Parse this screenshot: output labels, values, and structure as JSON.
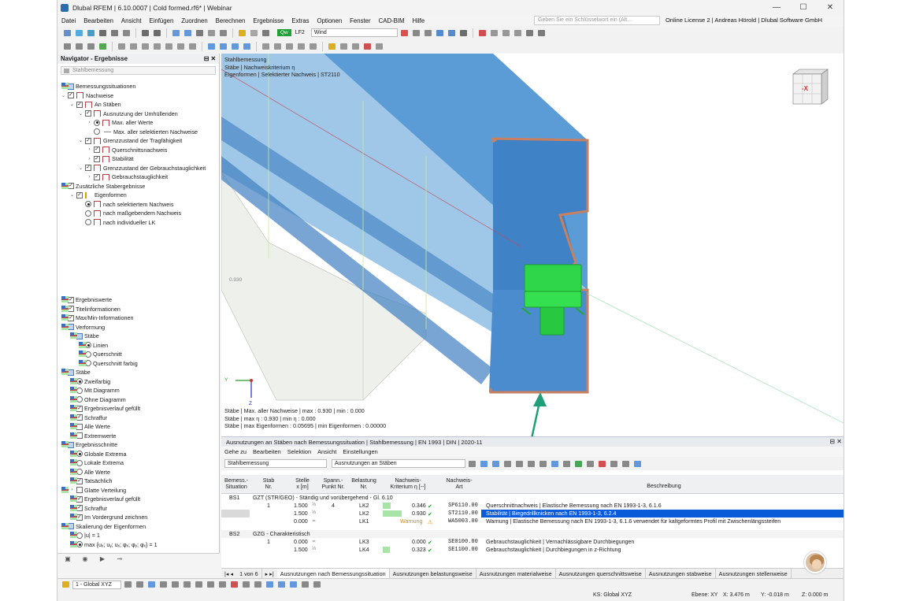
{
  "window": {
    "title": "Dlubal RFEM | 6.10.0007 | Cold formed.rf6* | Webinar",
    "controls": [
      "—",
      "☐",
      "✕"
    ]
  },
  "menu": [
    "Datei",
    "Bearbeiten",
    "Ansicht",
    "Einfügen",
    "Zuordnen",
    "Berechnen",
    "Ergebnisse",
    "Extras",
    "Optionen",
    "Fenster",
    "CAD-BIM",
    "Hilfe"
  ],
  "search": {
    "placeholder": "Geben Sie ein Schlüsselwort ein (Alt..."
  },
  "license": "Online License 2 | Andreas Hörold | Dlubal Software GmbH",
  "toolbar": {
    "qw_badge": "Qw",
    "lc_label": "LF2",
    "lc_name": "Wind"
  },
  "navigator": {
    "title": "Navigator - Ergebnisse",
    "combo": "Stahlbemessung",
    "top_items": [
      {
        "label": "Bemessungssituationen"
      },
      {
        "label": "Nachweise"
      },
      {
        "label": "An Stäben"
      },
      {
        "label": "Ausnutzung der Umhüllenden"
      },
      {
        "label": "Max. aller Werte"
      },
      {
        "label": "Max. aller selektierten Nachweise"
      },
      {
        "label": "Grenzzustand der Tragfähigkeit"
      },
      {
        "label": "Querschnittsnachweis"
      },
      {
        "label": "Stabilität"
      },
      {
        "label": "Grenzzustand der Gebrauchstauglichkeit"
      },
      {
        "label": "Gebrauchstauglichkeit"
      },
      {
        "label": "Zusätzliche Stabergebnisse"
      },
      {
        "label": "Eigenformen"
      },
      {
        "label": "nach selektiertem Nachweis"
      },
      {
        "label": "nach maßgebendem Nachweis"
      },
      {
        "label": "nach individueller LK"
      }
    ],
    "bottom_items": [
      {
        "label": "Ergebniswerte"
      },
      {
        "label": "Titelinformationen"
      },
      {
        "label": "Max/Min-Informationen"
      },
      {
        "label": "Verformung"
      },
      {
        "label": "Stäbe"
      },
      {
        "label": "Linien"
      },
      {
        "label": "Querschnitt"
      },
      {
        "label": "Querschnitt farbig"
      },
      {
        "label": "Stäbe"
      },
      {
        "label": "Zweifarbig"
      },
      {
        "label": "Mit Diagramm"
      },
      {
        "label": "Ohne Diagramm"
      },
      {
        "label": "Ergebnisverlauf gefüllt"
      },
      {
        "label": "Schraffur"
      },
      {
        "label": "Alle Werte"
      },
      {
        "label": "Extremwerte"
      },
      {
        "label": "Ergebnisschnitte"
      },
      {
        "label": "Globale Extrema"
      },
      {
        "label": "Lokale Extrema"
      },
      {
        "label": "Alle Werte"
      },
      {
        "label": "Tatsächlich"
      },
      {
        "label": "Glatte Verteilung"
      },
      {
        "label": "Ergebnisverlauf gefüllt"
      },
      {
        "label": "Schraffur"
      },
      {
        "label": "Im Vordergrund zeichnen"
      },
      {
        "label": "Skalierung der Eigenformen"
      },
      {
        "label": "|u| = 1"
      },
      {
        "label": "max {uₓ; uᵧ; uₓ; φₓ; φᵧ; φₓ} = 1"
      }
    ]
  },
  "viewport": {
    "info_lines": [
      "Stahlbemessung",
      "Stäbe | Nachweiskriterium η",
      "Eigenformen | Selektierter Nachweis | ST2110"
    ],
    "value_label": "0.930",
    "cube_label": "-X",
    "axis_y": "Y",
    "axis_z": "Z",
    "summary_lines": [
      "Stäbe | Max. aller Nachweise | max : 0.930 | min : 0.000",
      "Stäbe | max η : 0.930 | min η : 0.000",
      "Stäbe | max Eigenformen : 0.05695 | min Eigenformen : 0.00000"
    ]
  },
  "results": {
    "title": "Ausnutzungen an Stäben nach Bemessungssituation | Stahlbemessung | EN 1993 | DIN | 2020-11",
    "menu": [
      "Gehe zu",
      "Bearbeiten",
      "Selektion",
      "Ansicht",
      "Einstellungen"
    ],
    "combo1": "Stahlbemessung",
    "combo2": "Ausnutzungen an Stäben",
    "headers": {
      "situation": "Bemess.-\nSituation",
      "member": "Stab\nNr.",
      "location": "Stelle\nx [m]",
      "point": "Spann.-\nPunkt Nr.",
      "load": "Belastung\nNr.",
      "criterion": "Nachweis-\nKriterium η [--]",
      "type": "Nachweis-\nArt",
      "desc": "Beschreibung"
    },
    "group1": {
      "situation": "BS1",
      "label": "GZT (STR/GEO) - Ständig und vorübergehend - Gl. 6.10"
    },
    "rows1": [
      {
        "member": "1",
        "x": "1.500",
        "sub": "⅓",
        "point": "4",
        "load": "LK2",
        "value": "0.346",
        "check": "✔",
        "type": "SP6110.00",
        "desc": "Querschnittnachweis | Elastische Bemessung nach EN 1993-1-3, 6.1.6"
      },
      {
        "member": "",
        "x": "1.500",
        "sub": "⅓",
        "point": "",
        "load": "LK2",
        "value": "0.930",
        "check": "✔",
        "type": "ST2110.00",
        "desc": "Stabilität | Biegedrillknicken nach EN 1993-1-3, 6.2.4"
      },
      {
        "member": "",
        "x": "0.000",
        "sub": "≍",
        "point": "",
        "load": "LK1",
        "value": "Warnung",
        "check": "⚠",
        "type": "WA5003.00",
        "desc": "Warnung | Elastische Bemessung nach EN 1993-1-3, 6.1.6 verwendet für kaltgeformtes Profil mit Zwischenlängssteifen"
      }
    ],
    "group2": {
      "situation": "BS2",
      "label": "GZG - Charakteristisch"
    },
    "rows2": [
      {
        "member": "1",
        "x": "0.000",
        "sub": "≍",
        "point": "",
        "load": "LK3",
        "value": "0.000",
        "check": "✔",
        "type": "SE0100.00",
        "desc": "Gebrauchstauglichkeit | Vernachlässigbare Durchbiegungen"
      },
      {
        "member": "",
        "x": "1.500",
        "sub": "⅓",
        "point": "",
        "load": "LK4",
        "value": "0.323",
        "check": "✔",
        "type": "SE1100.00",
        "desc": "Gebrauchstauglichkeit | Durchbiegungen in z-Richtung"
      }
    ],
    "pager": "1 von 6",
    "tabs": [
      "Ausnutzungen nach Bemessungssituation",
      "Ausnutzungen belastungsweise",
      "Ausnutzungen materialweise",
      "Ausnutzungen querschnittsweise",
      "Ausnutzungen stabweise",
      "Ausnutzungen stellenweise"
    ]
  },
  "status": {
    "cs_combo": "1 - Global XYZ",
    "ks": "KS: Global XYZ",
    "plane": "Ebene: XY",
    "x": "X: 3.476 m",
    "y": "Y: -0.018 m",
    "z": "Z: 0.000 m"
  },
  "colors": {
    "accent": "#0a5bd8",
    "beam": "#5b9bd6",
    "profile_edge": "#c98060",
    "support": "#22cc33",
    "arrow": "#1f9e7a"
  }
}
